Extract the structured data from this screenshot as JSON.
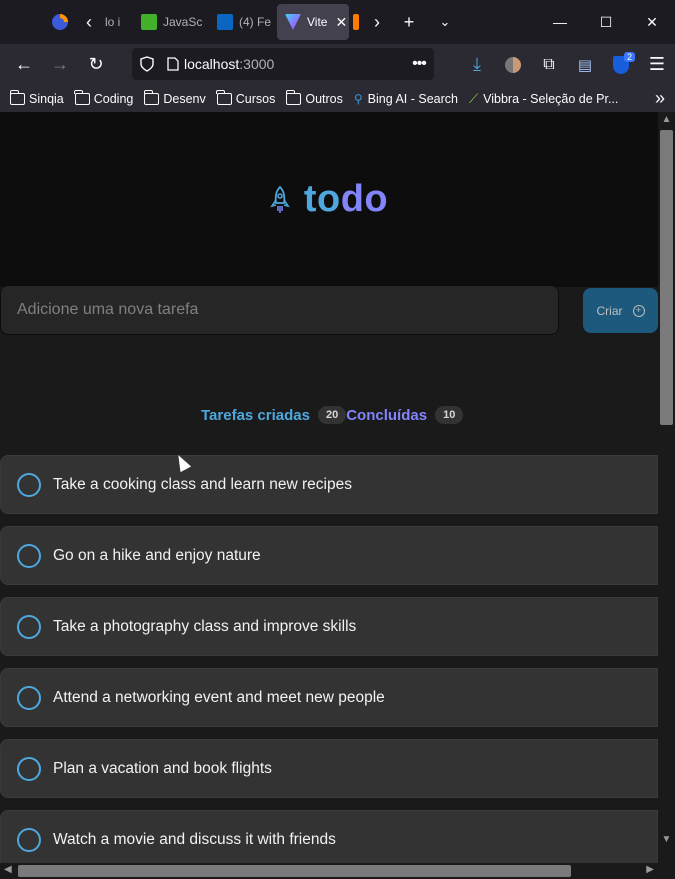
{
  "browser": {
    "tabs": [
      {
        "label": "lo i",
        "color": "#3a3a44"
      },
      {
        "label": "JavaSc",
        "color": "#43b02a"
      },
      {
        "label": "(4) Fe",
        "color": "#0a66c2"
      },
      {
        "label": "Vite",
        "color": "#bd34fe",
        "active": true
      },
      {
        "label": "",
        "color": "#ff7a00"
      }
    ],
    "url_host": "localhost",
    "url_port": ":3000",
    "bookmarks": [
      {
        "label": "Sinqia",
        "type": "folder"
      },
      {
        "label": "Coding",
        "type": "folder"
      },
      {
        "label": "Desenv",
        "type": "folder"
      },
      {
        "label": "Cursos",
        "type": "folder"
      },
      {
        "label": "Outros",
        "type": "folder"
      },
      {
        "label": "Bing AI - Search",
        "type": "link"
      },
      {
        "label": "Vibbra - Seleção de Pr...",
        "type": "link"
      }
    ],
    "extension_badge": "2"
  },
  "app": {
    "logo_part1": "to",
    "logo_part2": "do",
    "input_placeholder": "Adicione uma nova tarefa",
    "create_label": "Criar",
    "created_label": "Tarefas criadas",
    "created_count": "20",
    "done_label": "Concluídas",
    "done_count": "10",
    "tasks": [
      "Take a cooking class and learn new recipes",
      "Go on a hike and enjoy nature",
      "Take a photography class and improve skills",
      "Attend a networking event and meet new people",
      "Plan a vacation and book flights",
      "Watch a movie and discuss it with friends"
    ],
    "colors": {
      "blue": "#4ea8de",
      "purple": "#8284fa",
      "button": "#1e6f9f"
    }
  }
}
